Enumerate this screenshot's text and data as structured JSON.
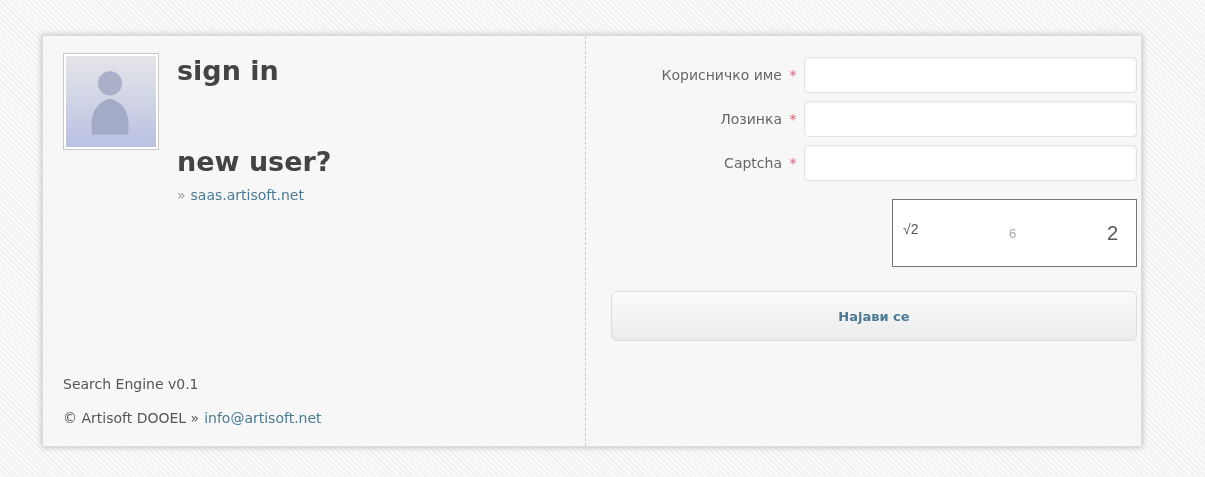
{
  "left": {
    "title": "sign in",
    "new_user": {
      "title": "new user?",
      "prefix": "»",
      "link": "saas.artisoft.net"
    },
    "footer": {
      "version": "Search Engine v0.1",
      "copyright": "© Artisoft DOOEL »",
      "email": "info@artisoft.net"
    }
  },
  "form": {
    "fields": [
      {
        "label": "Корисничко име",
        "required": true
      },
      {
        "label": "Лозинка",
        "required": true
      },
      {
        "label": "Captcha",
        "required": true
      }
    ],
    "required_mark": "*",
    "captcha": [
      "√2",
      "6",
      "2"
    ],
    "submit": "Најави се"
  }
}
